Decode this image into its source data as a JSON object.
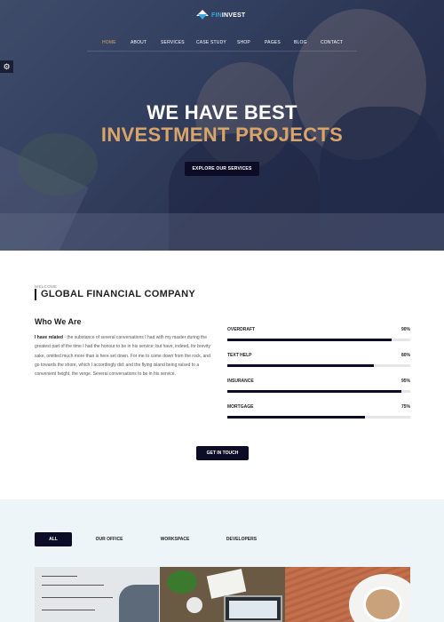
{
  "brand": {
    "logo_fin": "FIN",
    "logo_invest": "INVEST"
  },
  "nav": {
    "items": [
      {
        "label": "HOME",
        "active": true
      },
      {
        "label": "ABOUT",
        "active": false
      },
      {
        "label": "SERVICES",
        "active": false
      },
      {
        "label": "CASE STUDY",
        "active": false
      },
      {
        "label": "SHOP",
        "active": false
      },
      {
        "label": "PAGES",
        "active": false
      },
      {
        "label": "BLOG",
        "active": false
      },
      {
        "label": "CONTACT",
        "active": false
      }
    ]
  },
  "settings": {
    "icon": "gear-icon",
    "glyph": "⚙"
  },
  "hero": {
    "title_line1": "WE HAVE BEST",
    "title_line2": "INVESTMENT PROJECTS",
    "button_label": "EXPLORE OUR SERVICES"
  },
  "about": {
    "eyebrow": "WELCOME",
    "title": "GLOBAL FINANCIAL COMPANY",
    "who_title": "Who We Are",
    "who_lead": "I have related",
    "who_text": " - the substance of several conversations I had with my master during the greatest part of the time I had the honour to be in his service; but have, indeed, for brevity sake, omitted much more than is here set down. For me to come down from the rock, and go towards the shore, which I accordingly did: and the flying island being raised to a convenient height, the verge. Several conversations to be in his service.",
    "button_label": "GET IN TOUCH"
  },
  "skills": [
    {
      "label": "OVERDRAFT",
      "percent_label": "90%",
      "value": 90
    },
    {
      "label": "TEXT HELP",
      "percent_label": "80%",
      "value": 80
    },
    {
      "label": "INSURANCE",
      "percent_label": "95%",
      "value": 95
    },
    {
      "label": "MORTGAGE",
      "percent_label": "75%",
      "value": 75
    }
  ],
  "portfolio": {
    "filters": [
      {
        "label": "ALL",
        "active": true
      },
      {
        "label": "OUR OFFICE",
        "active": false
      },
      {
        "label": "WORKSPACE",
        "active": false
      },
      {
        "label": "DEVELOPERS",
        "active": false
      }
    ]
  },
  "colors": {
    "accent_gold": "#d9a46a",
    "brand_blue": "#3ea6e0",
    "dark_navy": "#0c0c26",
    "portfolio_bg": "#eef5f8"
  }
}
